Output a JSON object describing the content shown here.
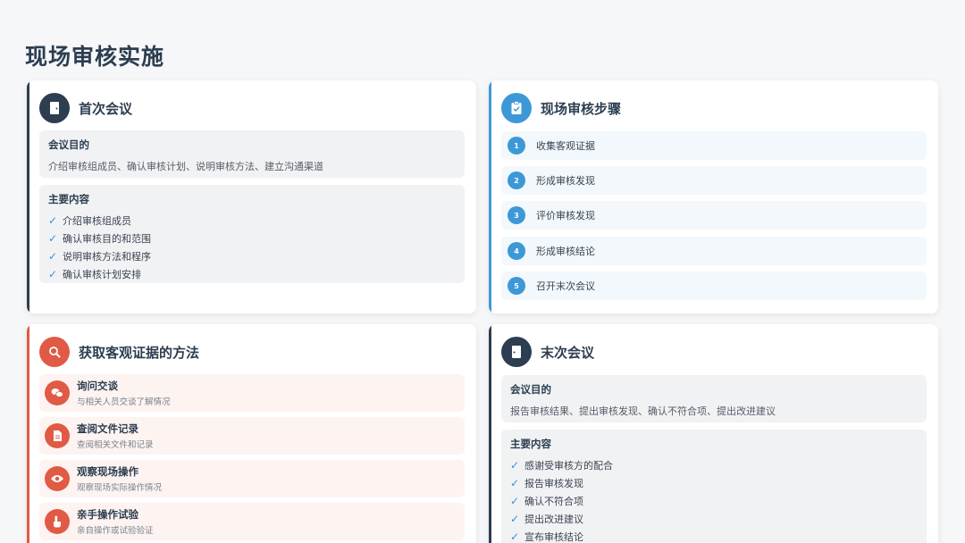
{
  "page": {
    "title": "现场审核实施"
  },
  "colors": {
    "dark": "#2c3e50",
    "blue": "#3d98d8",
    "red": "#e05a45"
  },
  "opening_meeting": {
    "title": "首次会议",
    "icon": "door-icon",
    "purpose_label": "会议目的",
    "purpose_text": "介绍审核组成员、确认审核计划、说明审核方法、建立沟通渠道",
    "content_label": "主要内容",
    "items": [
      "介绍审核组成员",
      "确认审核目的和范围",
      "说明审核方法和程序",
      "确认审核计划安排"
    ]
  },
  "audit_steps": {
    "title": "现场审核步骤",
    "icon": "clipboard-check-icon",
    "steps": [
      {
        "num": "1",
        "label": "收集客观证据"
      },
      {
        "num": "2",
        "label": "形成审核发现"
      },
      {
        "num": "3",
        "label": "评价审核发现"
      },
      {
        "num": "4",
        "label": "形成审核结论"
      },
      {
        "num": "5",
        "label": "召开末次会议"
      }
    ]
  },
  "evidence_methods": {
    "title": "获取客观证据的方法",
    "icon": "search-icon",
    "methods": [
      {
        "title": "询问交谈",
        "desc": "与相关人员交谈了解情况",
        "icon": "chat-icon"
      },
      {
        "title": "查阅文件记录",
        "desc": "查阅相关文件和记录",
        "icon": "document-icon"
      },
      {
        "title": "观察现场操作",
        "desc": "观察现场实际操作情况",
        "icon": "eye-icon"
      },
      {
        "title": "亲手操作试验",
        "desc": "亲自操作或试验验证",
        "icon": "hand-pointer-icon"
      }
    ]
  },
  "closing_meeting": {
    "title": "末次会议",
    "icon": "door-exit-icon",
    "purpose_label": "会议目的",
    "purpose_text": "报告审核结果、提出审核发现、确认不符合项、提出改进建议",
    "content_label": "主要内容",
    "items": [
      "感谢受审核方的配合",
      "报告审核发现",
      "确认不符合项",
      "提出改进建议",
      "宣布审核结论"
    ]
  }
}
